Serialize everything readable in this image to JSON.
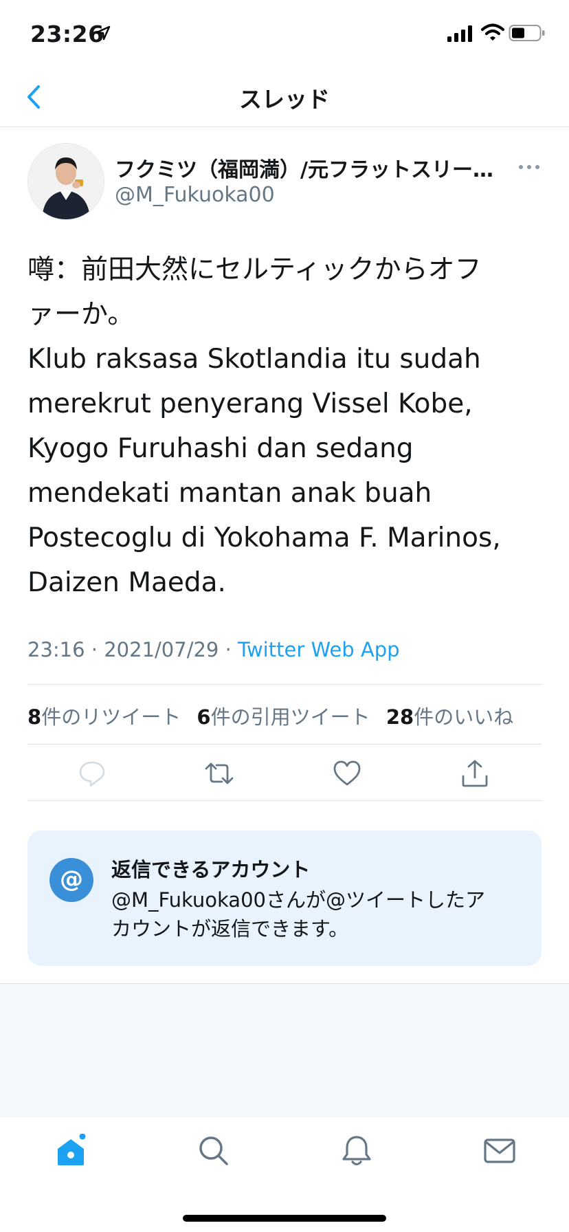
{
  "status_bar": {
    "time": "23:26"
  },
  "nav": {
    "title": "スレッド"
  },
  "tweet": {
    "author_name": "フクミツ（福岡満）/元フラットスリー…",
    "handle": "@M_Fukuoka00",
    "text_lines": [
      "噂：前田大然にセルティックからオフ",
      "ァーか。",
      "Klub raksasa Skotlandia itu sudah",
      "merekrut penyerang Vissel Kobe,",
      "Kyogo Furuhashi dan sedang",
      "mendekati mantan anak buah",
      "Postecoglu di Yokohama F. Marinos,",
      "Daizen Maeda."
    ],
    "time": "23:16",
    "date": "2021/07/29",
    "separator": "·",
    "source": "Twitter Web App",
    "stats": {
      "retweets_count": "8",
      "retweets_label": "件のリツイート",
      "quotes_count": "6",
      "quotes_label": "件の引用ツイート",
      "likes_count": "28",
      "likes_label": "件のいいね"
    }
  },
  "reply_restriction": {
    "icon": "@",
    "title": "返信できるアカウント",
    "description_lines": [
      "@M_Fukuoka00さんが@ツイートしたア",
      "カウントが返信できます。"
    ]
  },
  "tab_bar": {
    "items": [
      "home-icon",
      "search-icon",
      "notifications-icon",
      "messages-icon"
    ],
    "home_has_new_dot": true
  },
  "colors": {
    "accent": "#1da1f2",
    "secondary_text": "#657786",
    "reply_box_bg": "#e8f3fd"
  }
}
